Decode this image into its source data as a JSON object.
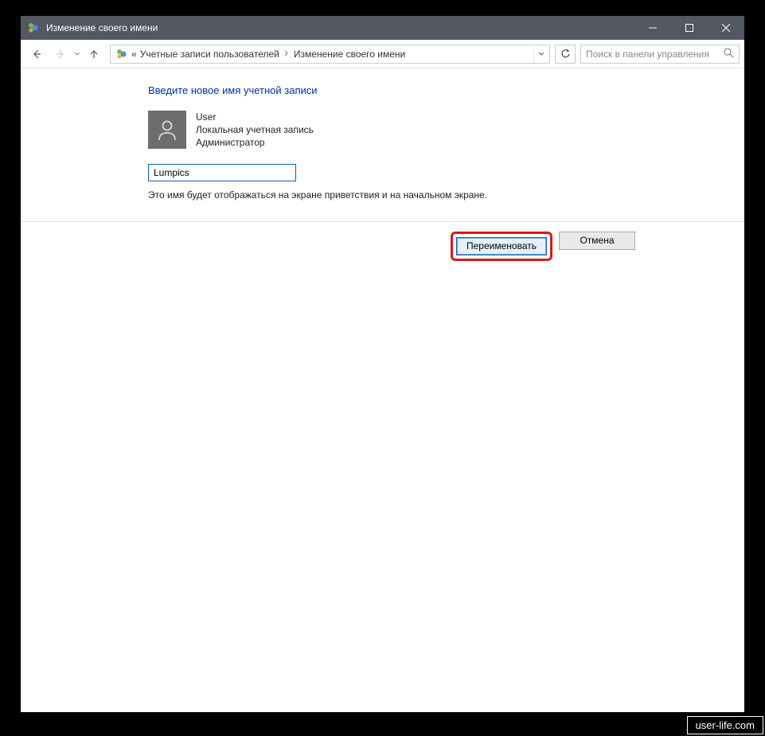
{
  "titlebar": {
    "title": "Изменение своего имени"
  },
  "breadcrumb": {
    "prefix": "«",
    "segments": [
      "Учетные записи пользователей",
      "Изменение своего имени"
    ]
  },
  "search": {
    "placeholder": "Поиск в панели управления"
  },
  "panel": {
    "heading": "Введите новое имя учетной записи",
    "user_name": "User",
    "user_type": "Локальная учетная запись",
    "user_role": "Администратор",
    "input_value": "Lumpics",
    "hint": "Это имя будет отображаться на экране приветствия и на начальном экране."
  },
  "buttons": {
    "rename": "Переименовать",
    "cancel": "Отмена"
  },
  "watermark": "user-life.com"
}
